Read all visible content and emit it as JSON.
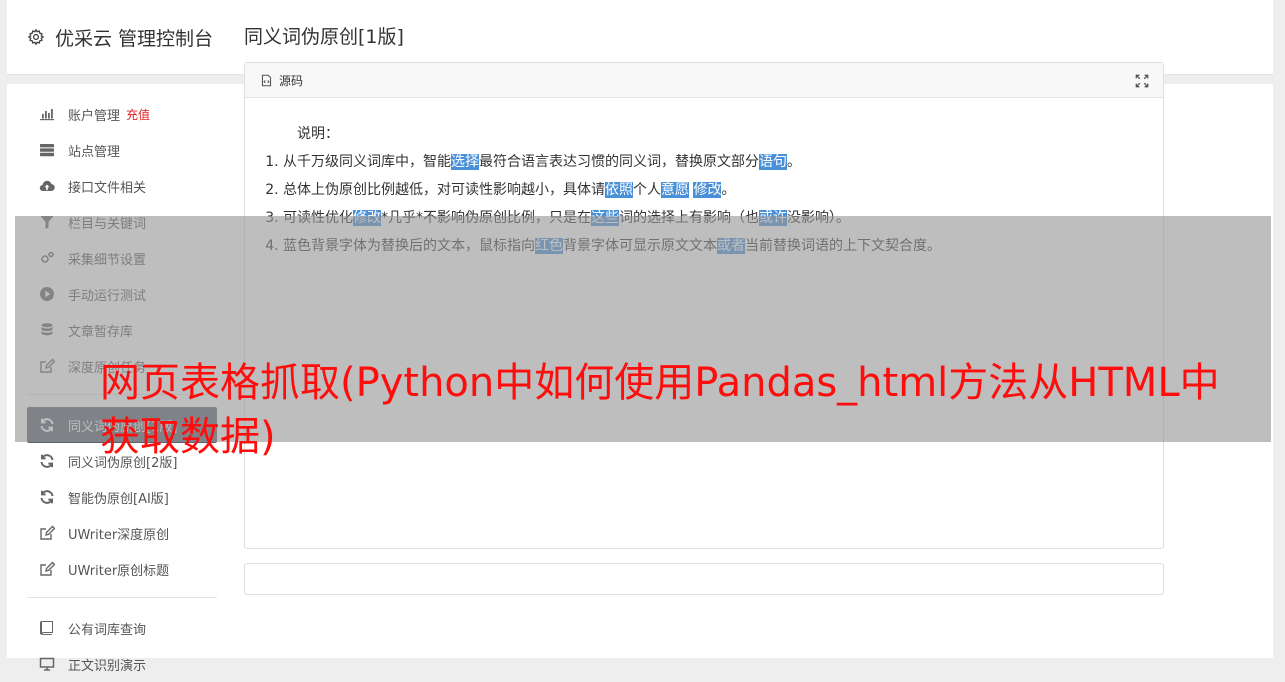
{
  "header": {
    "title": "优采云 管理控制台"
  },
  "sidebar": {
    "group1": [
      {
        "label": "账户管理",
        "badge": "充值",
        "icon": "bar-chart-icon"
      },
      {
        "label": "站点管理",
        "icon": "server-icon"
      },
      {
        "label": "接口文件相关",
        "icon": "cloud-upload-icon"
      },
      {
        "label": "栏目与关键词",
        "icon": "filter-icon"
      },
      {
        "label": "采集细节设置",
        "icon": "gears-icon"
      },
      {
        "label": "手动运行测试",
        "icon": "play-circle-icon"
      },
      {
        "label": "文章暂存库",
        "icon": "database-icon"
      },
      {
        "label": "深度原创任务",
        "icon": "edit-icon"
      }
    ],
    "group2": [
      {
        "label": "同义词伪原创[1版]",
        "icon": "refresh-icon",
        "active": true
      },
      {
        "label": "同义词伪原创[2版]",
        "icon": "refresh-icon"
      },
      {
        "label": "智能伪原创[AI版]",
        "icon": "refresh-icon"
      },
      {
        "label": "UWriter深度原创",
        "icon": "edit-icon"
      },
      {
        "label": "UWriter原创标题",
        "icon": "edit-icon"
      }
    ],
    "group3": [
      {
        "label": "公有词库查询",
        "icon": "book-icon"
      },
      {
        "label": "正文识别演示",
        "icon": "screen-icon"
      }
    ]
  },
  "main": {
    "title": "同义词伪原创[1版]",
    "card": {
      "header": "源码",
      "notes_title": "说明：",
      "notes": [
        [
          "从千万级同义词库中，智能",
          {
            "hl": "选择"
          },
          "最符合语言表达习惯的同义词，替换原文部分",
          {
            "hl": "语句"
          },
          "。"
        ],
        [
          "总体上伪原创比例越低，对可读性影响越小，具体请",
          {
            "hl": "依照"
          },
          "个人",
          {
            "hl": "意愿"
          },
          " ",
          {
            "hl": "修改"
          },
          "。"
        ],
        [
          "可读性优化",
          {
            "hl": "修改"
          },
          "*几乎*不影响伪原创比例，只是在",
          {
            "hl": "这些"
          },
          "词的选择上有影响（也",
          {
            "hl": "或许"
          },
          "没影响）。"
        ],
        [
          "蓝色背景字体为替换后的文本，鼠标指向",
          {
            "hl": "红色"
          },
          "背景字体可显示原文文本",
          {
            "hl": "或者"
          },
          "当前替换词语的上下文契合度。"
        ]
      ]
    }
  },
  "overlay": {
    "text": "网页表格抓取(Python中如何使用Pandas_html方法从HTML中获取数据)"
  },
  "colors": {
    "highlight": "#4a90d9",
    "active_nav": "#5a6170",
    "overlay_text": "#ff0c0c",
    "badge": "#e02020"
  }
}
